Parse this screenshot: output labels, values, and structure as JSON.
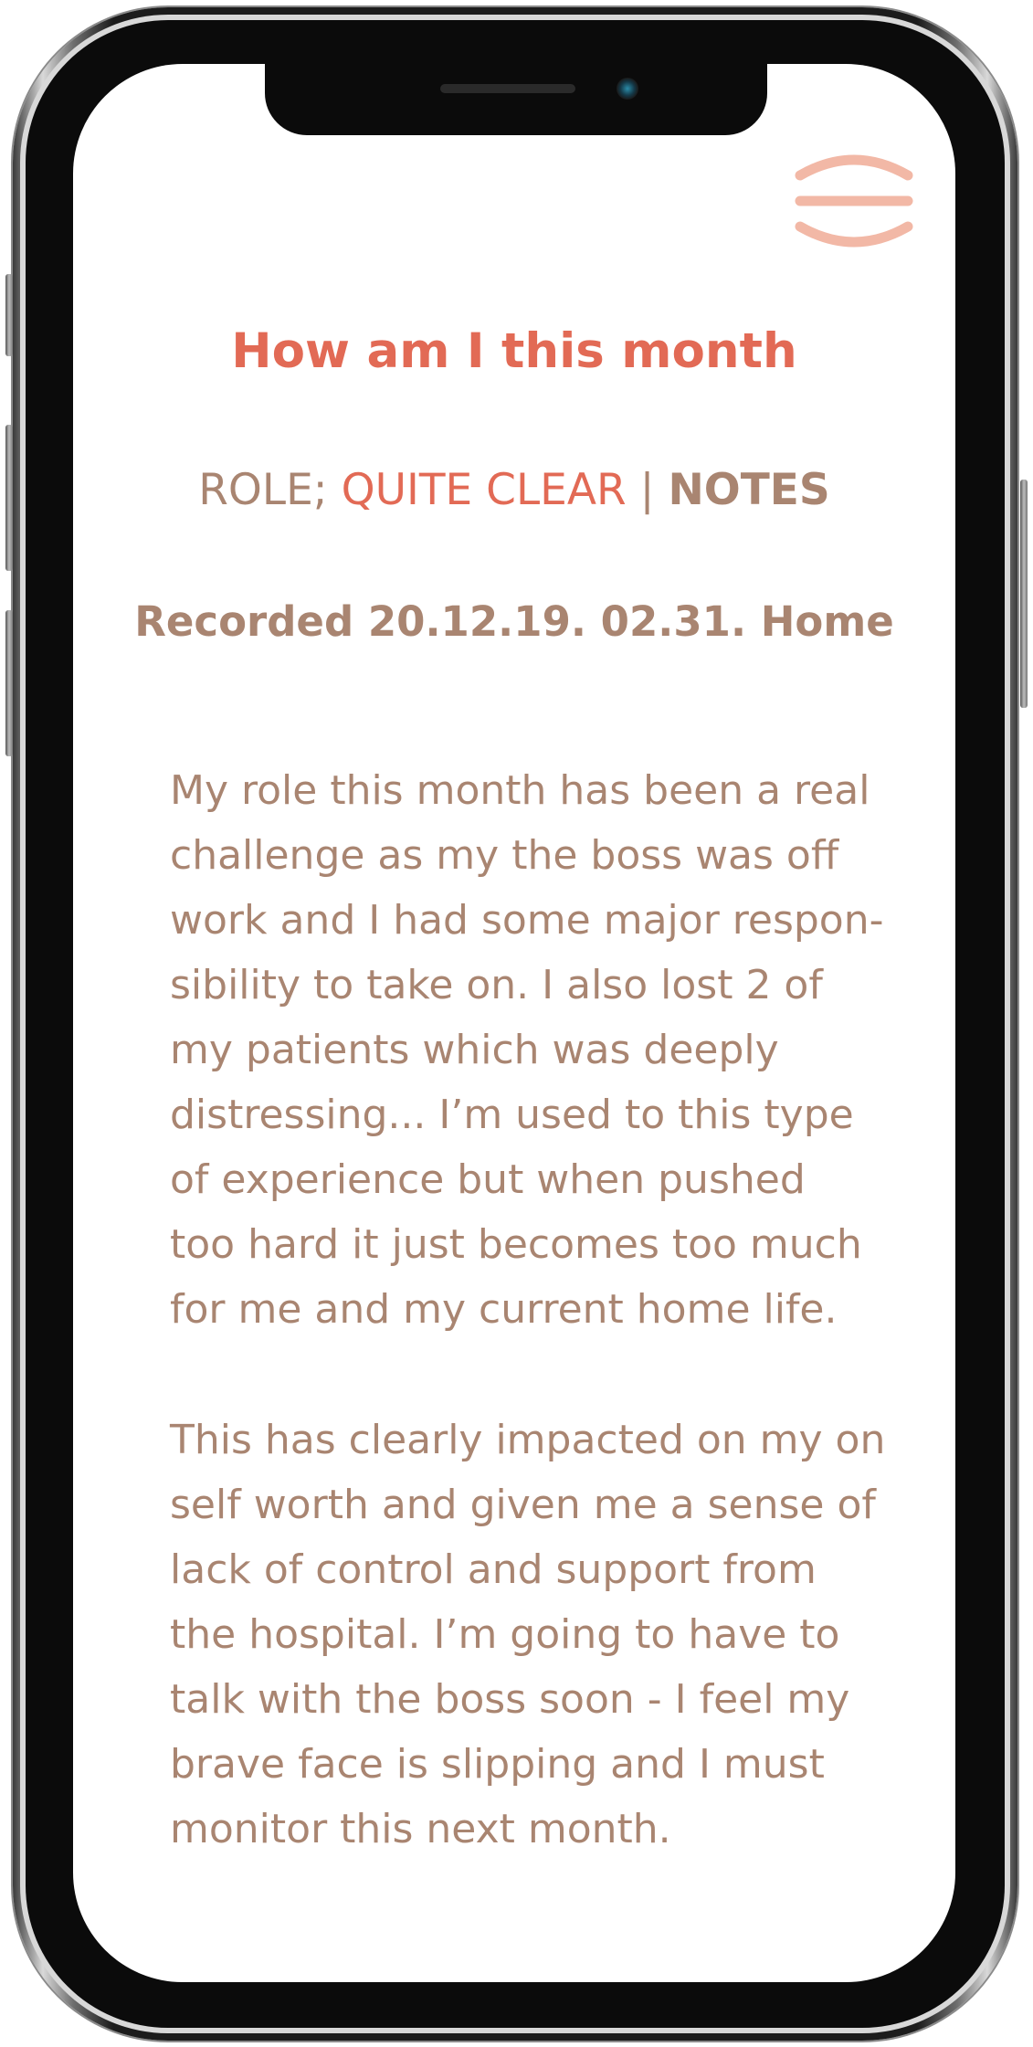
{
  "header": {
    "menu_icon": "menu-icon"
  },
  "page": {
    "title": "How am I this month",
    "role_label": "ROLE;",
    "role_value": "QUITE CLEAR",
    "separator": "|",
    "notes_label": "NOTES",
    "recorded": "Recorded 20.12.19. 02.31. Home"
  },
  "note": {
    "paragraph1": [
      "My role this month has been a real",
      "challenge as my the boss was off",
      "work and I had some major respon-",
      "sibility to take on. I also lost 2 of",
      "my patients which was deeply",
      "distressing... I’m used to this type",
      "of experience but when pushed",
      "too hard it just becomes too much",
      "for me and my current home life."
    ],
    "paragraph2": [
      "This has clearly impacted on my on",
      "self worth and given me a sense of",
      "lack of control and support from",
      "the hospital. I’m going to have to",
      "talk with the boss soon - I feel my",
      "brave face is slipping and I must",
      "monitor this next month."
    ]
  },
  "colors": {
    "accent": "#e26a55",
    "text": "#a98571",
    "menu_icon": "#f2b8a6"
  }
}
